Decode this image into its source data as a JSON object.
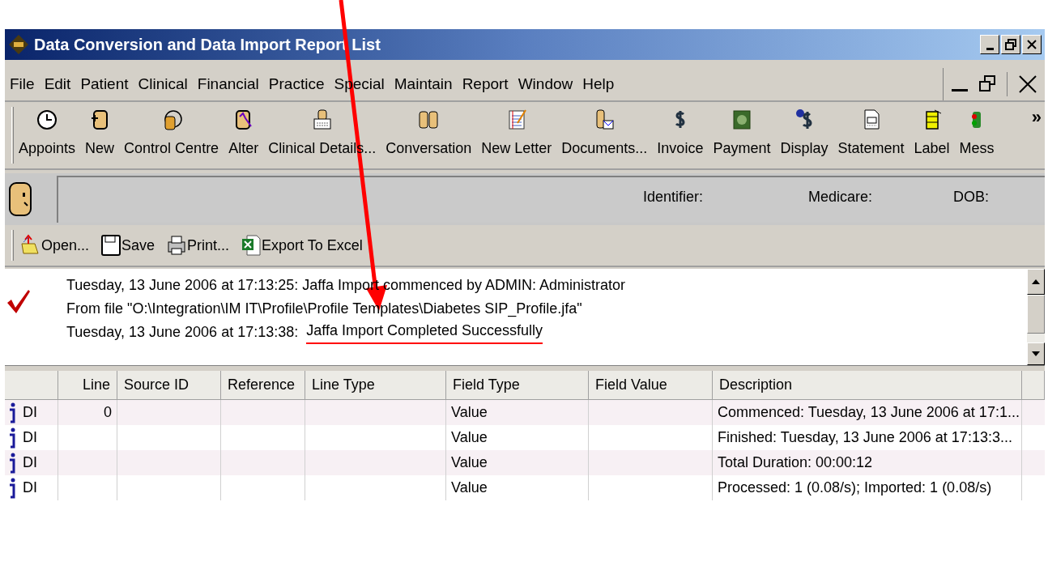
{
  "window": {
    "title": "Data Conversion and Data Import Report List"
  },
  "menu": [
    "File",
    "Edit",
    "Patient",
    "Clinical",
    "Financial",
    "Practice",
    "Special",
    "Maintain",
    "Report",
    "Window",
    "Help"
  ],
  "toolbar": [
    "Appoints",
    "New",
    "Control Centre",
    "Alter",
    "Clinical Details...",
    "Conversation",
    "New Letter",
    "Documents...",
    "Invoice",
    "Payment",
    "Display",
    "Statement",
    "Label",
    "Mess"
  ],
  "toolbar_overflow": "»",
  "patient_bar": {
    "labels": [
      "Identifier:",
      "Medicare:",
      "DOB:"
    ]
  },
  "report_toolbar": [
    "Open...",
    "Save",
    "Print...",
    "Export To Excel"
  ],
  "log": [
    {
      "text": "Tuesday, 13 June 2006 at 17:13:25:  Jaffa Import commenced by ADMIN:  Administrator"
    },
    {
      "text": "From file \"O:\\Integration\\IM IT\\Profile\\Profile Templates\\Diabetes SIP_Profile.jfa\""
    },
    {
      "text": "Tuesday, 13 June 2006 at 17:13:38:",
      "marked": "Jaffa Import Completed Successfully"
    }
  ],
  "table": {
    "columns": [
      "",
      "Line",
      "Source ID",
      "Reference",
      "Line Type",
      "Field Type",
      "Field Value",
      "Description"
    ],
    "rows": [
      {
        "type": "DI",
        "line": "0",
        "field_type": "Value",
        "description": "Commenced:  Tuesday, 13 June 2006 at 17:1..."
      },
      {
        "type": "DI",
        "field_type": "Value",
        "description": "Finished:  Tuesday, 13 June 2006 at 17:13:3..."
      },
      {
        "type": "DI",
        "field_type": "Value",
        "description": "Total Duration:  00:00:12"
      },
      {
        "type": "DI",
        "field_type": "Value",
        "description": "Processed:  1 (0.08/s); Imported:  1 (0.08/s)"
      }
    ]
  }
}
